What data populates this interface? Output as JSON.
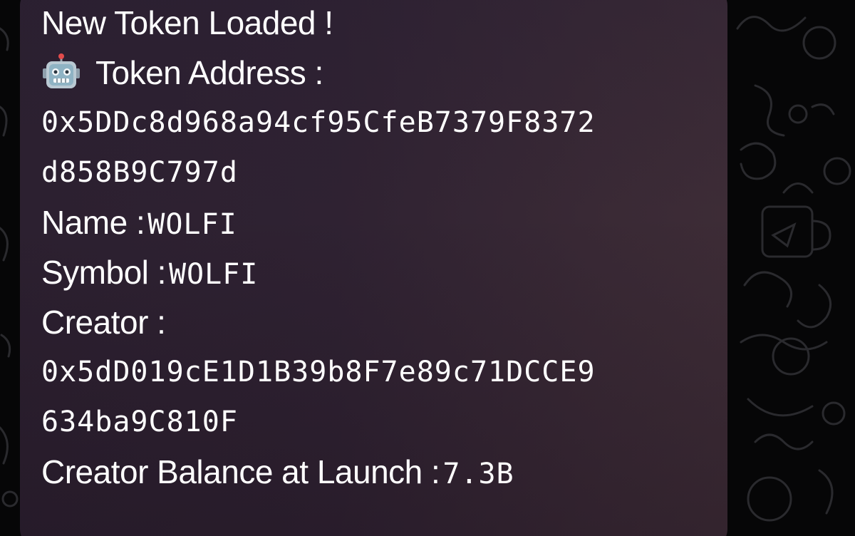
{
  "message": {
    "heading": "New Token Loaded !",
    "token_address_label": "Token Address :",
    "token_address_line1": "0x5DDc8d968a94cf95CfeB7379F8372",
    "token_address_line2": "d858B9C797d",
    "name_label": "Name :",
    "name_value": "WOLFI",
    "symbol_label": "Symbol :",
    "symbol_value": "WOLFI",
    "creator_label": "Creator :",
    "creator_line1": "0x5dD019cE1D1B39b8F7e89c71DCCE9",
    "creator_line2": "634ba9C810F",
    "balance_label": "Creator Balance at Launch :",
    "balance_value": "7.3B"
  },
  "icons": {
    "address_icon": "robot-face-icon"
  },
  "colors": {
    "bubble": "#2f2232",
    "text": "#ffffff",
    "background": "#060607"
  }
}
